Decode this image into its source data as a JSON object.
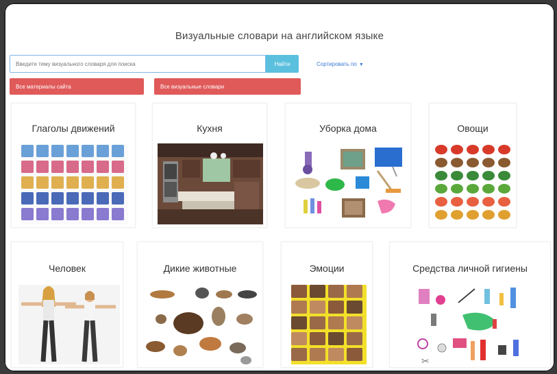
{
  "page": {
    "title": "Визуальные словари на английском языке"
  },
  "search": {
    "placeholder": "Введите тему визуального словаря для поиска",
    "button_label": "Найти",
    "sort_label": "Сортировать по"
  },
  "filters": {
    "all_materials": "Все материалы сайта",
    "all_dictionaries": "Все визуальные словари"
  },
  "cards": [
    {
      "title": "Глаголы движений"
    },
    {
      "title": "Кухня"
    },
    {
      "title": "Уборка дома"
    },
    {
      "title": "Овощи"
    },
    {
      "title": "Человек"
    },
    {
      "title": "Дикие животные"
    },
    {
      "title": "Эмоции"
    },
    {
      "title": "Средства личной гигиены"
    }
  ],
  "colors": {
    "search_button": "#5bc0de",
    "filter_button": "#e05a5a",
    "input_border": "#7fb5e8",
    "link": "#3a7bd5"
  }
}
